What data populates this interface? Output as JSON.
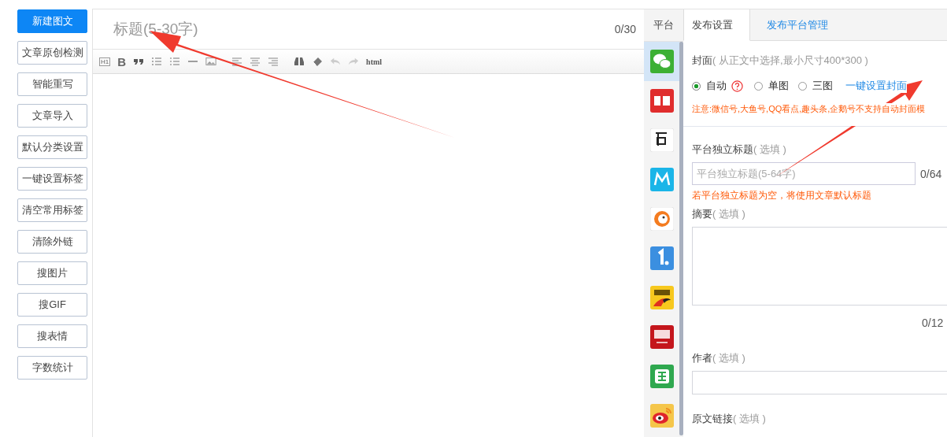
{
  "actions": [
    {
      "label": "新建图文",
      "primary": true
    },
    {
      "label": "文章原创检测",
      "primary": false
    },
    {
      "label": "智能重写",
      "primary": false
    },
    {
      "label": "文章导入",
      "primary": false
    },
    {
      "label": "默认分类设置",
      "primary": false
    },
    {
      "label": "一键设置标签",
      "primary": false
    },
    {
      "label": "清空常用标签",
      "primary": false
    },
    {
      "label": "清除外链",
      "primary": false
    },
    {
      "label": "搜图片",
      "primary": false
    },
    {
      "label": "搜GIF",
      "primary": false
    },
    {
      "label": "搜表情",
      "primary": false
    },
    {
      "label": "字数统计",
      "primary": false
    }
  ],
  "editor": {
    "title_placeholder": "标题(5-30字)",
    "title_counter": "0/30",
    "toolbar": [
      {
        "kind": "heading",
        "label": "H1"
      },
      {
        "kind": "bold",
        "label": "B"
      },
      {
        "kind": "quote"
      },
      {
        "kind": "ordered-list"
      },
      {
        "kind": "bullet-list"
      },
      {
        "kind": "rule"
      },
      {
        "kind": "image"
      },
      {
        "kind": "align-left"
      },
      {
        "kind": "align-center"
      },
      {
        "kind": "align-right"
      },
      {
        "kind": "find"
      },
      {
        "kind": "eraser"
      },
      {
        "kind": "undo"
      },
      {
        "kind": "redo"
      },
      {
        "kind": "html",
        "label": "html"
      }
    ]
  },
  "platforms": {
    "header": "平台",
    "items": [
      {
        "kind": "chat",
        "color": "#3cb034",
        "selected": true
      },
      {
        "kind": "headline",
        "color": "#e02d2d",
        "selected": false
      },
      {
        "kind": "paper",
        "color": "#ffffff",
        "selected": false
      },
      {
        "kind": "m",
        "color": "#1ab5e8",
        "selected": false
      },
      {
        "kind": "fish",
        "color": "#ffffff",
        "selected": false
      },
      {
        "kind": "one",
        "color": "#3b8fe0",
        "selected": false
      },
      {
        "kind": "fox",
        "color": "#f7c81e",
        "selected": false
      },
      {
        "kind": "news",
        "color": "#c4161c",
        "selected": false
      },
      {
        "kind": "fun",
        "color": "#2fa84f",
        "selected": false
      },
      {
        "kind": "eye",
        "color": "#f5c64a",
        "selected": false
      }
    ]
  },
  "settings": {
    "tabs": [
      {
        "label": "发布设置",
        "selected": true
      },
      {
        "label": "发布平台管理",
        "selected": false
      }
    ],
    "cover": {
      "label": "封面",
      "hint": "( 从正文中选择,最小尺寸400*300 )",
      "options": [
        {
          "label": "自动",
          "selected": true,
          "help": true
        },
        {
          "label": "单图",
          "selected": false,
          "help": false
        },
        {
          "label": "三图",
          "selected": false,
          "help": false
        }
      ],
      "link": "一键设置封面",
      "notice": "注意:微信号,大鱼号,QQ看点,趣头条,企鹅号不支持自动封面模"
    },
    "platform_title": {
      "label": "平台独立标题",
      "hint": "( 选填 )",
      "placeholder": "平台独立标题(5-64字)",
      "counter": "0/64",
      "note": "若平台独立标题为空，将使用文章默认标题"
    },
    "summary": {
      "label": "摘要",
      "hint": "( 选填 )",
      "counter": "0/12"
    },
    "author": {
      "label": "作者",
      "hint": "( 选填 )"
    },
    "source_link": {
      "label": "原文链接",
      "hint": "( 选填 )"
    }
  }
}
